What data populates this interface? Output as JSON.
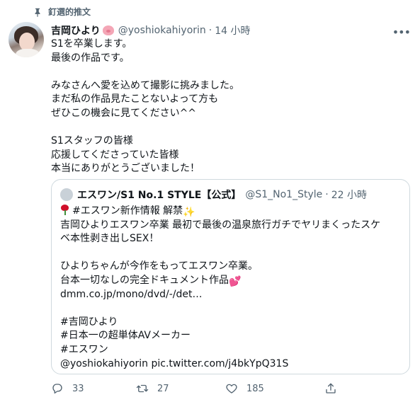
{
  "pinned_label": "釘選的推文",
  "author": {
    "display_name": "吉岡ひより",
    "handle": "@yoshiokahiyorin",
    "time": "14 小時"
  },
  "tweet_lines": [
    "S1を卒業します。",
    "最後の作品です。",
    "",
    "みなさんへ愛を込めて撮影に挑みました。",
    "まだ私の作品見たことないよって方も",
    "ぜひこの機会に見てください^^",
    "",
    "S1スタッフの皆様",
    "応援してくださっていた皆様",
    "本当にありがとうございました！"
  ],
  "quote": {
    "display_name": "エスワン/S1 No.1 STYLE【公式】",
    "handle": "@S1_No1_Style",
    "time": "22 小時",
    "line1_text": "#エスワン新作情報 解禁",
    "lines": [
      "吉岡ひよりエスワン卒業 最初で最後の温泉旅行ガチでヤリまくったスケ",
      "ベ本性剥き出しSEX！",
      "",
      "ひよりちゃんが今作をもってエスワン卒業。"
    ],
    "line_doc": "台本一切なしの完全ドキュメント作品",
    "lines2": [
      "dmm.co.jp/mono/dvd/-/det…",
      "",
      "#吉岡ひより",
      "#日本一の超単体AVメーカー",
      "#エスワン",
      "@yoshiokahiyorin pic.twitter.com/j4bkYpQ31S"
    ]
  },
  "actions": {
    "reply_count": "33",
    "retweet_count": "27",
    "like_count": "185"
  },
  "icons": {
    "pin": "pin-icon",
    "pig": "pig-emoji",
    "more": "more-icon",
    "rose": "rose-emoji",
    "sparkle": "sparkles-emoji",
    "hearts": "two-hearts-emoji",
    "reply": "reply-icon",
    "retweet": "retweet-icon",
    "like": "heart-icon",
    "share": "share-icon"
  },
  "colors": {
    "secondary_text": "#536471",
    "border": "#cfd9de",
    "primary_text": "#0f1419"
  }
}
